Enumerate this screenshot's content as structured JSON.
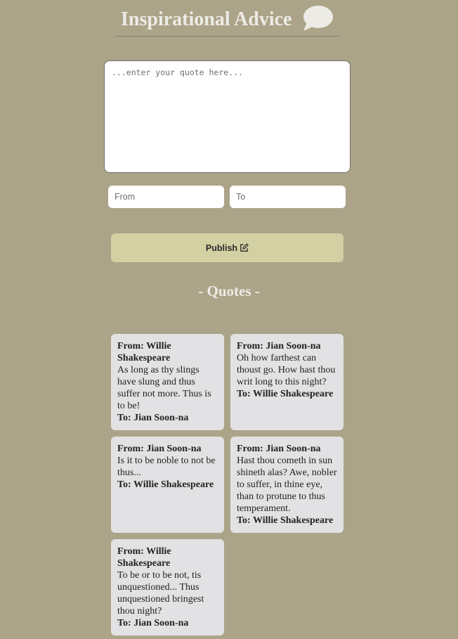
{
  "header": {
    "title": "Inspirational Advice",
    "icon": "speech-bubble-icon"
  },
  "form": {
    "quote_placeholder": "...enter your quote here...",
    "from_placeholder": "From",
    "to_placeholder": "To",
    "publish_label": "Publish",
    "publish_icon": "edit-icon"
  },
  "quotes_heading": "- Quotes -",
  "quotes": [
    {
      "from": "From: Willie Shakespeare",
      "text": "As long as thy slings have slung and thus suffer not more. Thus is to be!",
      "to": "To: Jian Soon-na"
    },
    {
      "from": "From: Jian Soon-na",
      "text": "Oh how farthest can thoust go. How hast thou writ long to this night?",
      "to": "To: Willie Shakespeare"
    },
    {
      "from": "From: Jian Soon-na",
      "text": "Is it to be noble to not be thus...",
      "to": "To: Willie Shakespeare"
    },
    {
      "from": "From: Jian Soon-na",
      "text": "Hast thou cometh in sun shineth alas? Awe, nobler to suffer, in thine eye, than to protune to thus temperament.",
      "to": "To: Willie Shakespeare"
    },
    {
      "from": "From: Willie Shakespeare",
      "text": "To be or to be not, tis unquestioned... Thus unquestioned bringest thou night?",
      "to": "To: Jian Soon-na"
    }
  ],
  "colors": {
    "background": "#aca488",
    "card": "#e2e2e4",
    "button": "#d3d1a3",
    "heading_text": "#ecebe6"
  }
}
